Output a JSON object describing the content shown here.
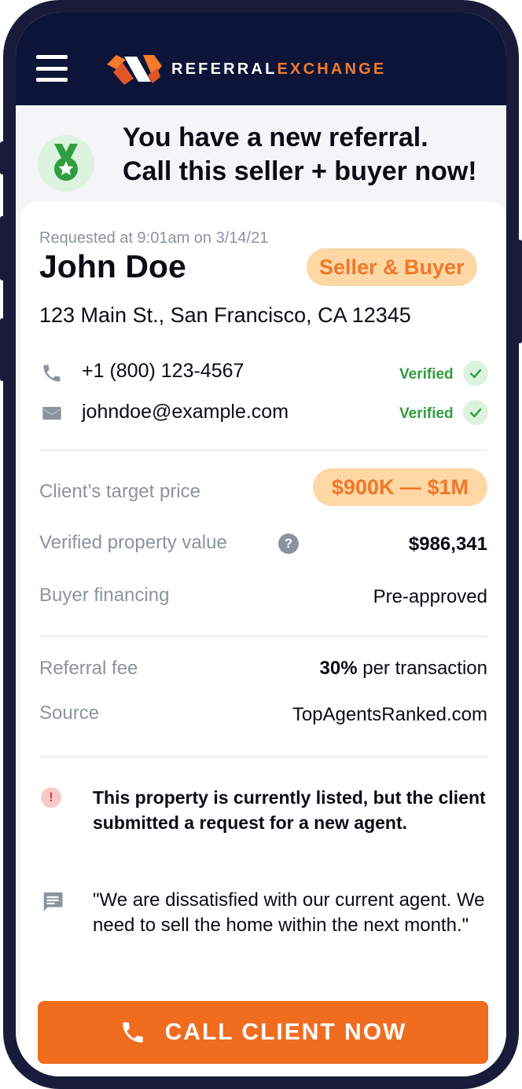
{
  "header": {
    "brand_part1": "REFERRAL",
    "brand_part2": "EXCHANGE",
    "menu_icon": "hamburger-menu-icon"
  },
  "notice": {
    "line1": "You have a new referral.",
    "line2": "Call this seller + buyer now!",
    "icon": "medal-icon"
  },
  "referral": {
    "requested": "Requested at 9:01am on 3/14/21",
    "name": "John Doe",
    "type": "Seller & Buyer",
    "address": "123 Main St., San Francisco, CA 12345",
    "phone": "+1 (800) 123-4567",
    "phone_status": "Verified",
    "email": "johndoe@example.com",
    "email_status": "Verified"
  },
  "details": {
    "target_price_label": "Client’s target price",
    "target_price_value": "$900K — $1M",
    "property_value_label": "Verified property value",
    "property_value": "$986,341",
    "help_glyph": "?",
    "financing_label": "Buyer financing",
    "financing_value": "Pre-approved",
    "fee_label": "Referral fee",
    "fee_percent": "30%",
    "fee_suffix": "per transaction",
    "source_label": "Source",
    "source_value": "TopAgentsRanked.com"
  },
  "alerts": {
    "alert_glyph": "!",
    "listed_warning": "This property is currently listed, but the client submitted a request for a new agent.",
    "client_comment": "\"We are dissatisfied with our current agent. We need to sell the home within the next month.\""
  },
  "cta": {
    "label": "CALL CLIENT NOW"
  },
  "colors": {
    "nav_bg": "#0c1537",
    "accent": "#f06c1f",
    "badge_bg": "#fdd7a4",
    "verified_green": "#2f9e3f"
  }
}
